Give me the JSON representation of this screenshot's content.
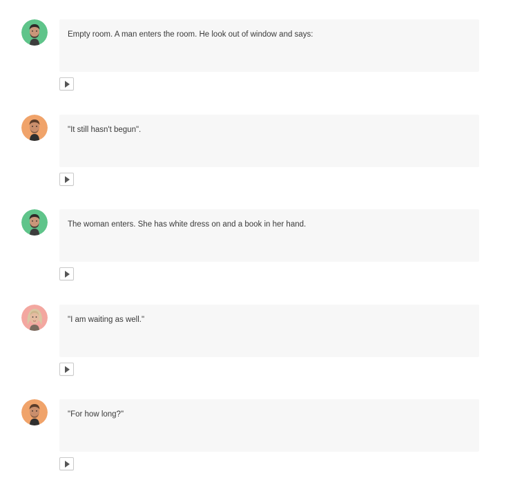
{
  "messages": [
    {
      "speaker": "man-green",
      "avatar_bg": "#5fc48a",
      "text": "Empty room. A man enters the room. He look out of window and says:",
      "play_icon": "play-icon"
    },
    {
      "speaker": "man-orange",
      "avatar_bg": "#f0a36a",
      "text": "\"It still hasn't begun\".",
      "play_icon": "play-icon"
    },
    {
      "speaker": "man-green",
      "avatar_bg": "#5fc48a",
      "text": "The woman enters. She has white dress on and a book in her hand.",
      "play_icon": "play-icon"
    },
    {
      "speaker": "woman-pink",
      "avatar_bg": "#f3a7a0",
      "text": "\"I am waiting as well.\"",
      "play_icon": "play-icon"
    },
    {
      "speaker": "man-orange",
      "avatar_bg": "#f0a36a",
      "text": "\"For how long?\"",
      "play_icon": "play-icon"
    }
  ]
}
